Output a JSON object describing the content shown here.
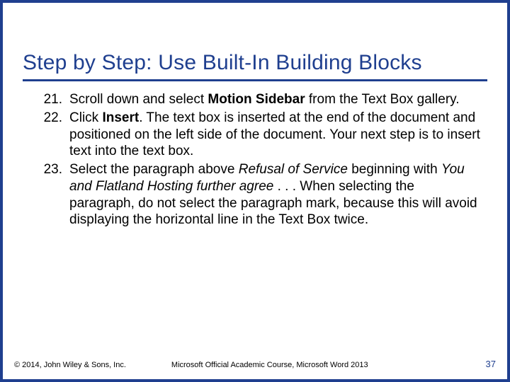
{
  "title": "Step by Step: Use Built-In Building Blocks",
  "steps": [
    {
      "num": "21.",
      "parts": [
        {
          "t": "Scroll down and select "
        },
        {
          "t": "Motion Sidebar",
          "cls": "bold"
        },
        {
          "t": " from the Text Box gallery."
        }
      ]
    },
    {
      "num": "22.",
      "parts": [
        {
          "t": "Click "
        },
        {
          "t": "Insert",
          "cls": "bold"
        },
        {
          "t": ". The text box is inserted at the end of the document and positioned on the left side of the document. Your next step is to insert text into the text box."
        }
      ]
    },
    {
      "num": "23.",
      "parts": [
        {
          "t": "Select the paragraph above "
        },
        {
          "t": "Refusal of Service",
          "cls": "italic"
        },
        {
          "t": " beginning with "
        },
        {
          "t": "You and Flatland Hosting further agree",
          "cls": "italic"
        },
        {
          "t": " . . . When selecting the paragraph, do not select the paragraph mark, because this will avoid displaying the horizontal line in the Text Box twice."
        }
      ]
    }
  ],
  "footer": {
    "copyright": "© 2014, John Wiley & Sons, Inc.",
    "course": "Microsoft Official Academic Course, Microsoft Word 2013",
    "pagenum": "37"
  }
}
